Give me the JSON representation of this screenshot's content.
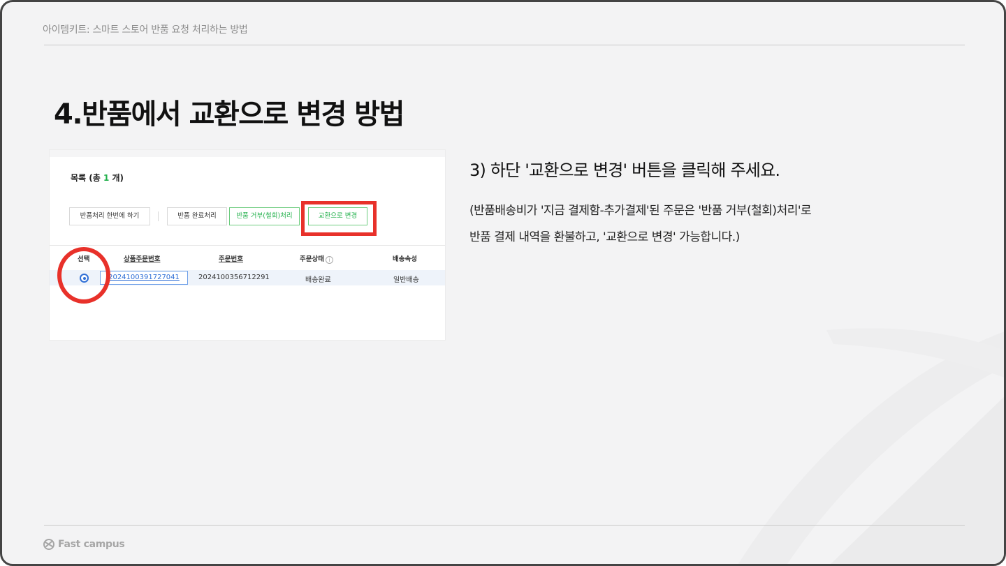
{
  "header": {
    "title": "아이템키트: 스마트 스토어 반품 요청 처리하는 방법"
  },
  "main_title": "4.반품에서 교환으로 변경 방법",
  "screenshot": {
    "list_title_prefix": "목록 (총 ",
    "list_count": "1",
    "list_title_suffix": " 개)",
    "buttons": {
      "batch": "반품처리 한번에 하기",
      "complete": "반품 완료처리",
      "reject": "반품 거부(철회)처리",
      "exchange": "교환으로 변경"
    },
    "columns": {
      "select": "선택",
      "product_order_no": "상품주문번호",
      "order_no": "주문번호",
      "order_status": "주문상태",
      "shipping": "배송속성"
    },
    "row": {
      "product_order_no": "2024100391727041",
      "order_no": "2024100356712291",
      "order_status": "배송완료",
      "shipping": "일반배송"
    }
  },
  "step": {
    "title": "3) 하단 '교환으로 변경' 버튼을 클릭해 주세요.",
    "note_line1": "(반품배송비가 '지금 결제함-추가결제'된 주문은 '반품 거부(철회)처리'로",
    "note_line2": "반품 결제 내역을 환불하고, '교환으로 변경' 가능합니다.)"
  },
  "footer": {
    "logo_text": "Fast campus",
    "logo_icon": "fastcampus-logo-icon"
  },
  "colors": {
    "highlight_red": "#e8312a",
    "accent_green": "#21b04b",
    "link_blue": "#2f6fd6"
  }
}
